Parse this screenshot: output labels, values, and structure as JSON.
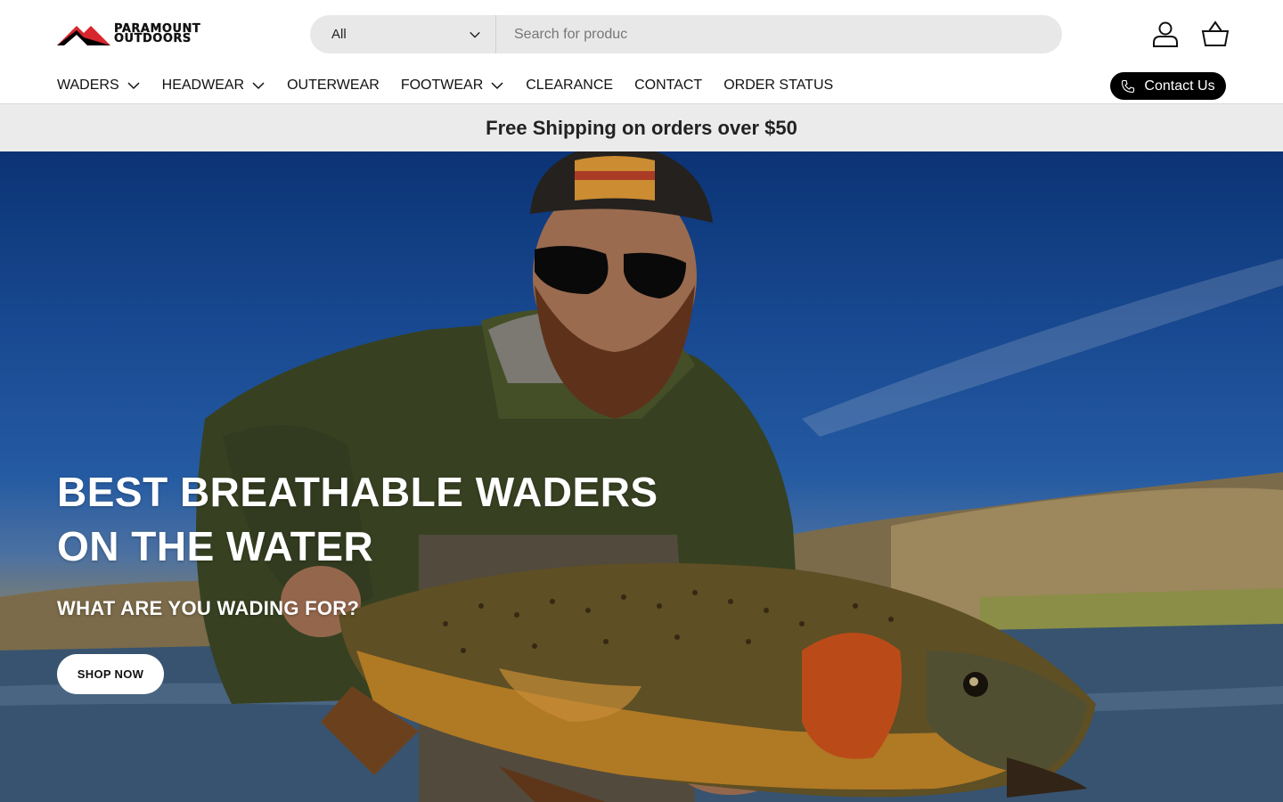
{
  "brand": {
    "line1": "PARAMOUNT",
    "line2": "OUTDOORS"
  },
  "search": {
    "category": "All",
    "placeholder": "Search for produc"
  },
  "nav": {
    "items": [
      {
        "label": "WADERS",
        "dropdown": true
      },
      {
        "label": "HEADWEAR",
        "dropdown": true
      },
      {
        "label": "OUTERWEAR",
        "dropdown": false
      },
      {
        "label": "FOOTWEAR",
        "dropdown": true
      },
      {
        "label": "CLEARANCE",
        "dropdown": false
      },
      {
        "label": "CONTACT",
        "dropdown": false
      },
      {
        "label": "ORDER STATUS",
        "dropdown": false
      }
    ],
    "contact_button": "Contact Us"
  },
  "announcement": "Free Shipping on orders over $50",
  "hero": {
    "title": "BEST BREATHABLE WADERS ON THE WATER",
    "subtitle": "WHAT ARE YOU WADING FOR?",
    "button": "SHOP NOW"
  },
  "icons": {
    "account": "user-icon",
    "cart": "basket-icon",
    "phone": "phone-icon",
    "chevron": "chevron-down-icon"
  },
  "colors": {
    "brand_red": "#d7262e",
    "black": "#000000",
    "announce_bg": "#ebebeb",
    "search_bg": "#e8e8e8"
  }
}
